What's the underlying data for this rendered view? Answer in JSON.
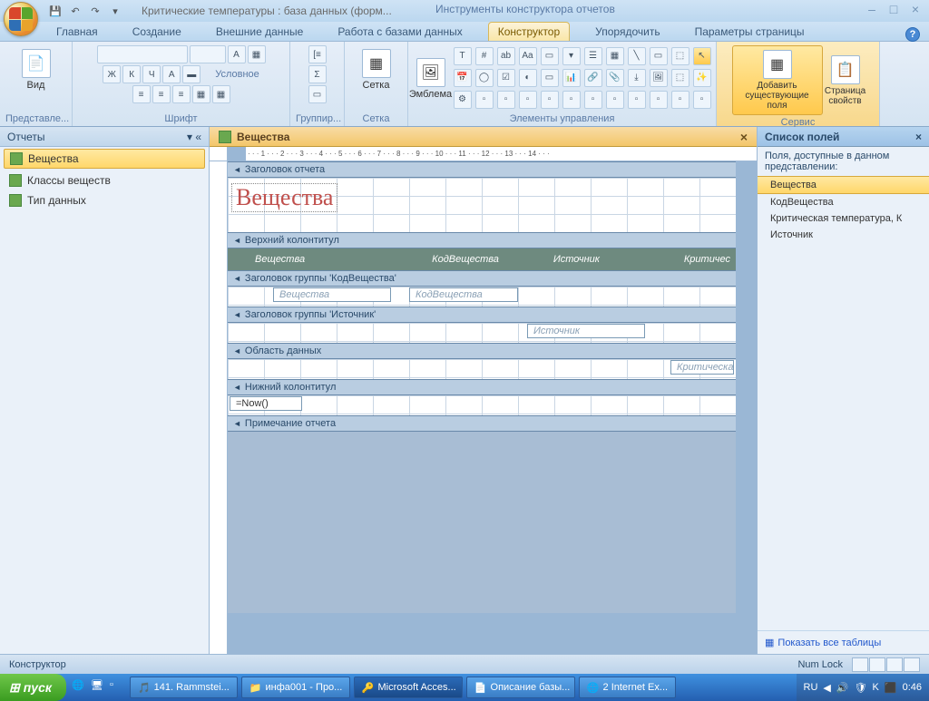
{
  "title": "Критические температуры : база данных (форм...",
  "toolsTitle": "Инструменты конструктора отчетов",
  "tabs": {
    "home": "Главная",
    "create": "Создание",
    "external": "Внешние данные",
    "dbtools": "Работа с базами данных",
    "designer": "Конструктор",
    "arrange": "Упорядочить",
    "pagesetup": "Параметры страницы"
  },
  "groups": {
    "views": "Представле...",
    "viewBtn": "Вид",
    "font": "Шрифт",
    "conditional": "Условное",
    "grouping": "Группир...",
    "grid": "Сетка",
    "gridBtn": "Сетка",
    "emblem": "Эмблема",
    "controls": "Элементы управления",
    "addFields": "Добавить существующие поля",
    "propSheet": "Страница свойств",
    "service": "Сервис"
  },
  "fontButtons": {
    "b": "Ж",
    "i": "К",
    "u": "Ч",
    "a": "A"
  },
  "nav": {
    "header": "Отчеты",
    "items": [
      "Вещества",
      "Классы веществ",
      "Тип данных"
    ]
  },
  "docTab": "Вещества",
  "ruler": "· · · 1 · · · 2 · · · 3 · · · 4 · · · 5 · · · 6 · · · 7 · · · 8 · · · 9 · · · 10 · · · 11 · · · 12 · · · 13 · · · 14 · · ·",
  "sections": {
    "reportHeader": "Заголовок отчета",
    "pageHeader": "Верхний колонтитул",
    "groupHeader1": "Заголовок группы 'КодВещества'",
    "groupHeader2": "Заголовок группы 'Источник'",
    "detail": "Область данных",
    "pageFooter": "Нижний колонтитул",
    "reportFooter": "Примечание отчета"
  },
  "reportTitle": "Вещества",
  "headerCols": {
    "c1": "Вещества",
    "c2": "КодВещества",
    "c3": "Источник",
    "c4": "Критичес"
  },
  "fields": {
    "f1": "Вещества",
    "f2": "КодВещества",
    "f3": "Источник",
    "f4": "Критическа",
    "now": "=Now()"
  },
  "fieldList": {
    "title": "Список полей",
    "sub": "Поля, доступные в данном представлении:",
    "items": [
      "Вещества",
      "КодВещества",
      "Критическая температура, К",
      "Источник"
    ],
    "footer": "Показать все таблицы"
  },
  "status": {
    "mode": "Конструктор",
    "numlock": "Num Lock"
  },
  "taskbar": {
    "start": "пуск",
    "items": [
      "141. Rammstei...",
      "инфа001 - Про...",
      "Microsoft Acces...",
      "Описание базы...",
      "2 Internet Ex..."
    ],
    "lang": "RU",
    "time": "0:46"
  }
}
